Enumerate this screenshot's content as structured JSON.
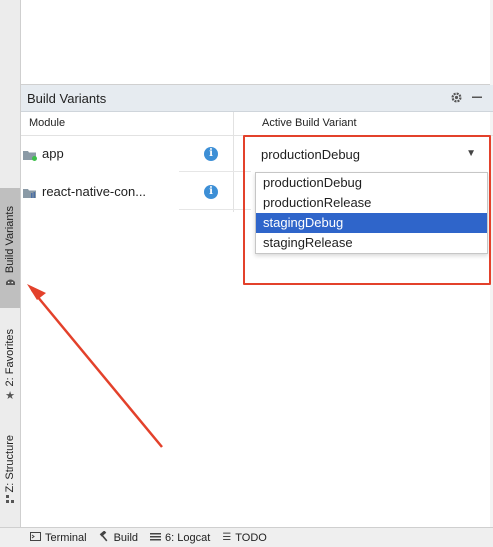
{
  "panel": {
    "title": "Build Variants",
    "columns": {
      "module": "Module",
      "active_variant": "Active Build Variant"
    }
  },
  "modules": [
    {
      "name": "app",
      "icon": "android-module-folder-icon"
    },
    {
      "name": "react-native-con...",
      "icon": "library-module-folder-icon"
    }
  ],
  "variant_select": {
    "value": "productionDebug",
    "options": [
      "productionDebug",
      "productionRelease",
      "stagingDebug",
      "stagingRelease"
    ],
    "highlighted": "stagingDebug"
  },
  "left_tabs": [
    {
      "label": "Build Variants",
      "icon": "android-icon"
    },
    {
      "label": "2: Favorites",
      "icon": "star-icon"
    },
    {
      "label": "Z: Structure",
      "icon": "structure-icon"
    }
  ],
  "bottom_tabs": [
    {
      "label": "Terminal",
      "icon": "terminal-icon"
    },
    {
      "label": "Build",
      "icon": "hammer-icon"
    },
    {
      "label": "6: Logcat",
      "icon": "logcat-icon"
    },
    {
      "label": "TODO",
      "icon": "todo-list-icon"
    }
  ],
  "colors": {
    "annotation_red": "#e3412b",
    "selection_blue": "#2f65ca",
    "info_blue": "#3d8fd6"
  }
}
